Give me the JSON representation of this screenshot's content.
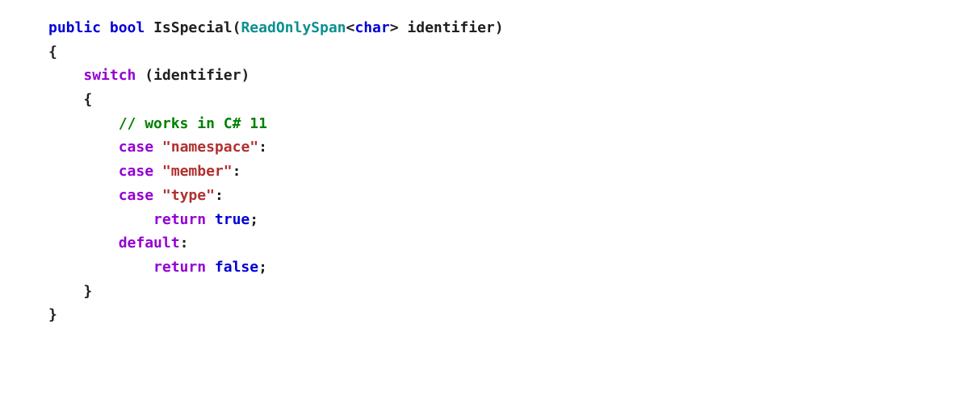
{
  "code": {
    "line01": {
      "public": "public",
      "bool": "bool",
      "method": "IsSpecial",
      "lparen": "(",
      "span_type": "ReadOnlySpan",
      "lt": "<",
      "char_type": "char",
      "gt": ">",
      "param": " identifier",
      "rparen": ")"
    },
    "line02": {
      "open_brace": "{"
    },
    "line03": {
      "switch": "switch",
      "lparen": " (",
      "expr": "identifier",
      "rparen": ")"
    },
    "line04": {
      "open_brace": "{"
    },
    "line05": {
      "comment": "// works in C# 11"
    },
    "line06": {
      "case": "case",
      "str": "\"namespace\"",
      "colon": ":"
    },
    "line07": {
      "case": "case",
      "str": "\"member\"",
      "colon": ":"
    },
    "line08": {
      "case": "case",
      "str": "\"type\"",
      "colon": ":"
    },
    "line09": {
      "return": "return",
      "true": "true",
      "semi": ";"
    },
    "line10": {
      "default": "default",
      "colon": ":"
    },
    "line11": {
      "return": "return",
      "false": "false",
      "semi": ";"
    },
    "line12": {
      "close_brace": "}"
    },
    "line13": {
      "close_brace": "}"
    }
  }
}
